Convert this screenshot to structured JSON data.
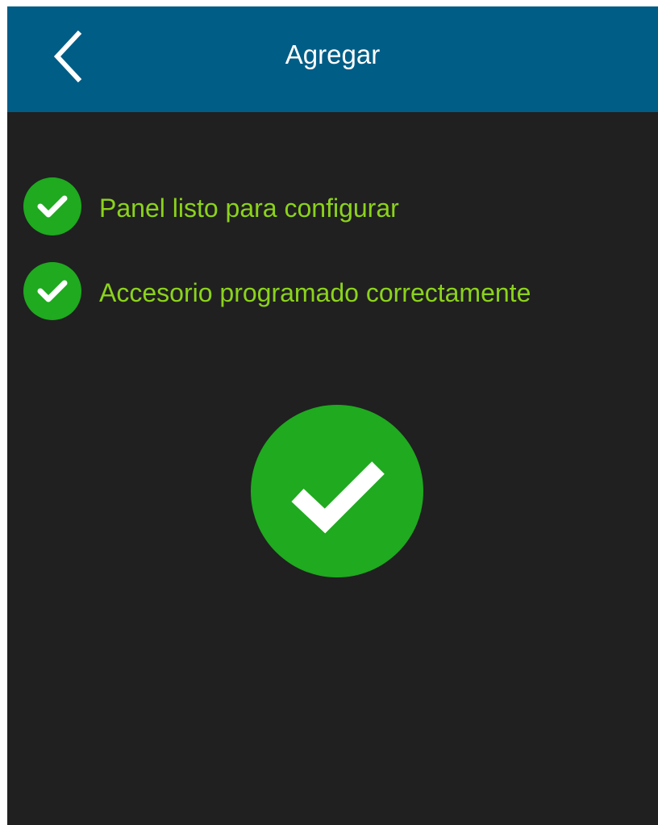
{
  "app_bar": {
    "title": "Agregar",
    "back_icon": "chevron-left-icon",
    "background_color": "#005d86"
  },
  "status_list": {
    "items": [
      {
        "label": "Panel listo para configurar",
        "icon": "check-circle-icon"
      },
      {
        "label": "Accesorio programado correctamente",
        "icon": "check-circle-icon"
      }
    ]
  },
  "result": {
    "icon": "check-circle-large-icon"
  },
  "colors": {
    "background": "#202020",
    "success_green": "#1faa1f",
    "label_green": "#8bd31b",
    "check_mark": "#ffffff"
  }
}
